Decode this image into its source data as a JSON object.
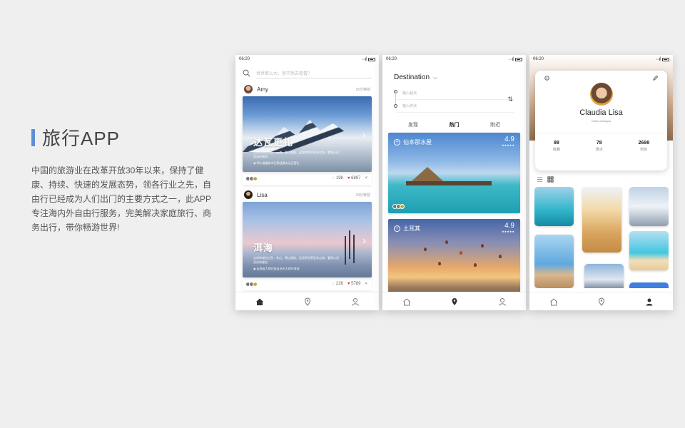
{
  "intro": {
    "title": "旅行APP",
    "description": "中国的旅游业在改革开放30年以来，保持了健康、持续、快速的发展态势，领各行业之先，自由行已经成为人们出门的主要方式之一，此APP专注海内外自由行服务，完美解决家庭旅行、商务出行，带你畅游世界!"
  },
  "status_time": "06:20",
  "accent_color": "#5b8fd6",
  "feed": {
    "search_placeholder": "世界那么大，我不想去看看？",
    "posts": [
      {
        "user": "Amy",
        "time": "15分钟前",
        "title": "达瓦更扎",
        "desc": "古朴自然的东方，云海，雪山相依，这里的世界没有尘埃，看到心灵洗涤的感觉",
        "location": "四川省雅安市石棉县雅安达瓦更扎",
        "comments": "198",
        "likes": "6897",
        "badge": "+2"
      },
      {
        "user": "Lisa",
        "time": "19分钟前",
        "title": "洱海",
        "desc": "洁净的湖光山色，苍山，雪山相依，这里的世界没有尘埃，看到心灵洗涤的感觉",
        "location": "云南省大理白族自治州大理市洱海",
        "comments": "226",
        "likes": "5789",
        "badge": "+2"
      }
    ]
  },
  "discover": {
    "header": "Destination",
    "from_placeholder": "输入起点",
    "to_placeholder": "输入终点",
    "filters": [
      "发现",
      "热门",
      "附近"
    ],
    "active_filter": "热门",
    "destinations": [
      {
        "name": "仙本那水屋",
        "rating": "4.9",
        "stars": "★★★★★",
        "badge": "+2"
      },
      {
        "name": "土耳其",
        "rating": "4.9",
        "stars": "★★★★★"
      }
    ]
  },
  "profile": {
    "name": "Claudia Lisa",
    "location": "China chengdu",
    "stats": [
      {
        "value": "98",
        "label": "收藏"
      },
      {
        "value": "78",
        "label": "景点"
      },
      {
        "value": "2698",
        "label": "粉丝"
      }
    ]
  },
  "icons": {
    "tab_home": "home-icon",
    "tab_map": "location-pin-icon",
    "tab_user": "user-icon"
  }
}
